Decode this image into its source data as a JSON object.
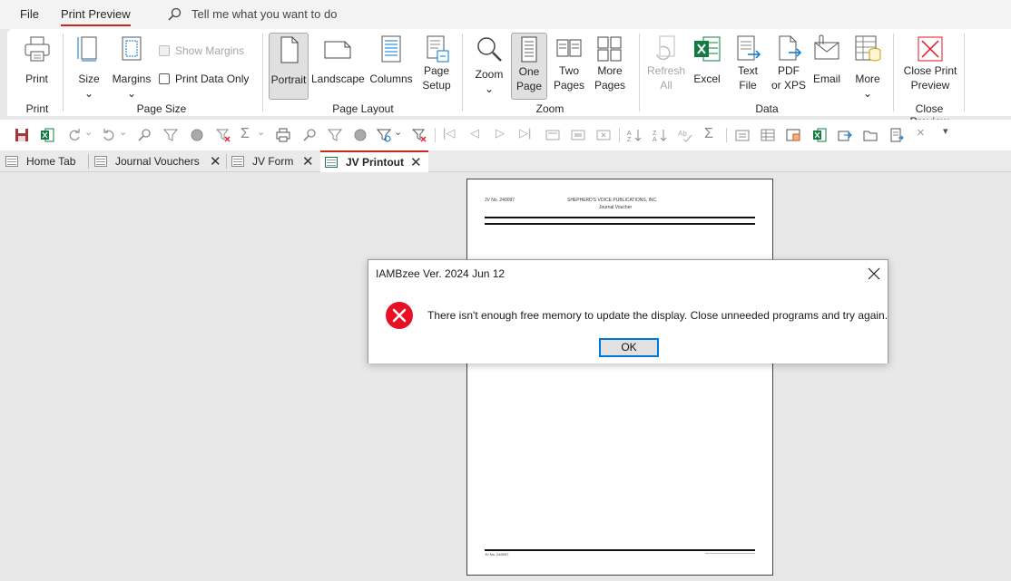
{
  "menu": {
    "file": "File",
    "print_preview": "Print Preview",
    "tell_me": "Tell me what you want to do"
  },
  "ribbon": {
    "print": {
      "button": "Print",
      "group": "Print"
    },
    "page_size": {
      "size": "Size",
      "margins": "Margins",
      "show_margins": "Show Margins",
      "print_data_only": "Print Data Only",
      "group": "Page Size"
    },
    "page_layout": {
      "portrait": "Portrait",
      "landscape": "Landscape",
      "columns": "Columns",
      "page_setup_1": "Page",
      "page_setup_2": "Setup",
      "group": "Page Layout"
    },
    "zoom": {
      "zoom": "Zoom",
      "one_page_1": "One",
      "one_page_2": "Page",
      "two_pages_1": "Two",
      "two_pages_2": "Pages",
      "more_pages_1": "More",
      "more_pages_2": "Pages",
      "group": "Zoom"
    },
    "data": {
      "refresh_1": "Refresh",
      "refresh_2": "All",
      "excel": "Excel",
      "text_file_1": "Text",
      "text_file_2": "File",
      "pdf_1": "PDF",
      "pdf_2": "or XPS",
      "email": "Email",
      "more": "More",
      "group": "Data"
    },
    "close_preview": {
      "close_1": "Close Print",
      "close_2": "Preview",
      "group": "Close Preview"
    }
  },
  "tabs": [
    {
      "label": "Home Tab"
    },
    {
      "label": "Journal Vouchers"
    },
    {
      "label": "JV Form"
    },
    {
      "label": "JV Printout"
    }
  ],
  "page": {
    "jv_no": "JV No. 240097",
    "company": "SHEPHERD'S VOICE PUBLICATIONS, INC.",
    "doc_title": "Journal Voucher",
    "footer_left": "JV No.     240097"
  },
  "dialog": {
    "title": "IAMBzee Ver. 2024 Jun 12",
    "message": "There isn't enough free memory to update the display. Close unneeded programs and try again.",
    "ok": "OK"
  },
  "colors": {
    "accent_red": "#c42b1c",
    "error_icon": "#e81123",
    "excel_green": "#107c41",
    "access_maroon": "#a4373a",
    "focus_blue": "#0078d7"
  }
}
